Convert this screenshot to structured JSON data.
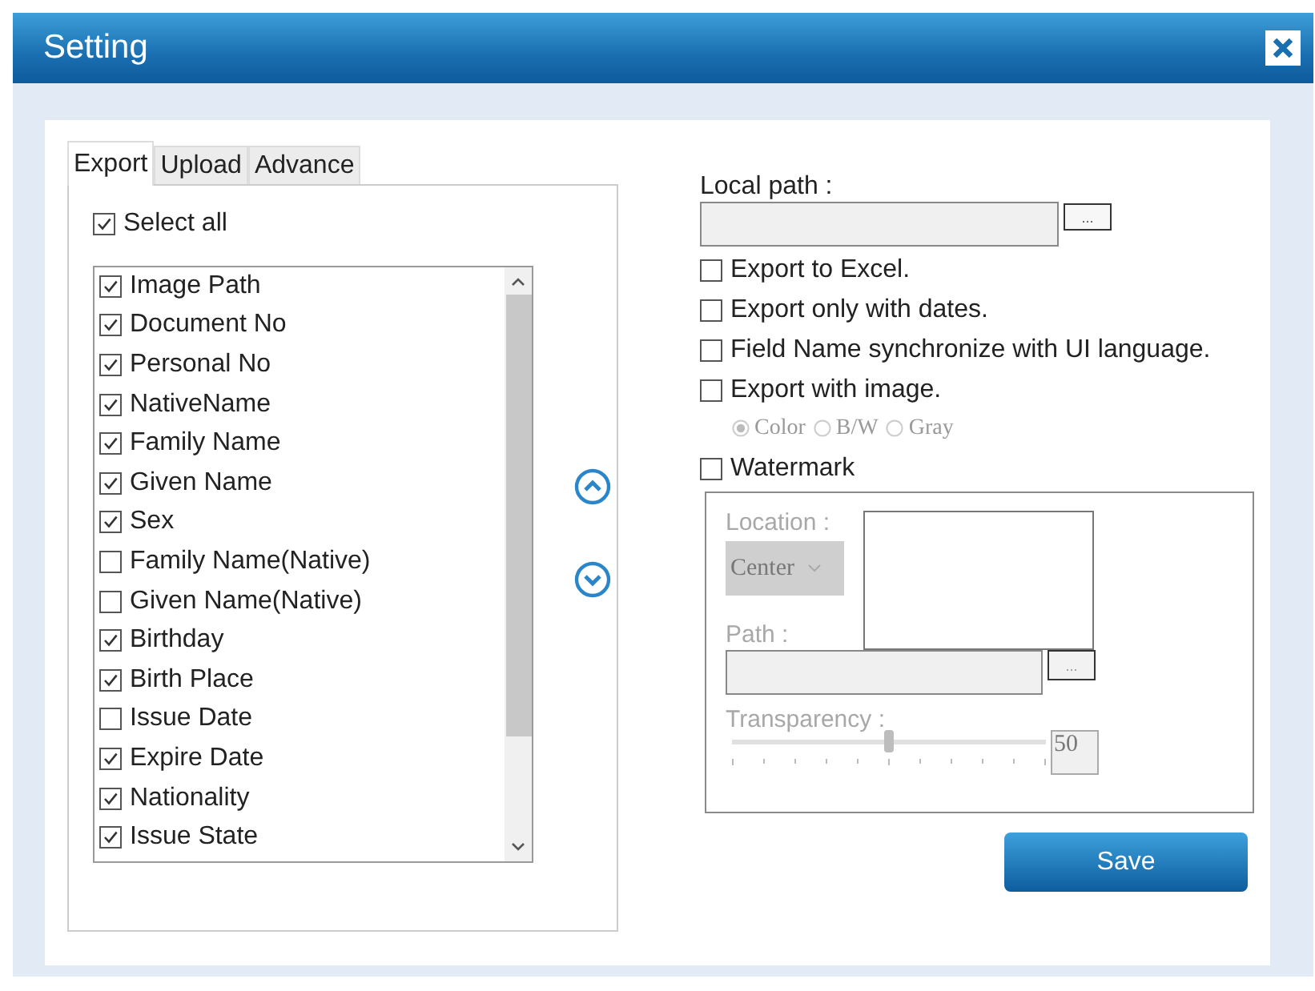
{
  "window": {
    "title": "Setting"
  },
  "tabs": [
    {
      "label": "Export",
      "selected": true
    },
    {
      "label": "Upload",
      "selected": false
    },
    {
      "label": "Advance",
      "selected": false
    }
  ],
  "select_all": {
    "label": "Select all",
    "checked": true
  },
  "fields": [
    {
      "label": "Image Path",
      "checked": true
    },
    {
      "label": "Document No",
      "checked": true
    },
    {
      "label": "Personal No",
      "checked": true
    },
    {
      "label": "NativeName",
      "checked": true
    },
    {
      "label": "Family Name",
      "checked": true
    },
    {
      "label": "Given Name",
      "checked": true
    },
    {
      "label": "Sex",
      "checked": true
    },
    {
      "label": "Family Name(Native)",
      "checked": false
    },
    {
      "label": "Given Name(Native)",
      "checked": false
    },
    {
      "label": "Birthday",
      "checked": true
    },
    {
      "label": "Birth Place",
      "checked": true
    },
    {
      "label": "Issue Date",
      "checked": false
    },
    {
      "label": "Expire Date",
      "checked": true
    },
    {
      "label": "Nationality",
      "checked": true
    },
    {
      "label": "Issue State",
      "checked": true
    }
  ],
  "local_path": {
    "label": "Local path :",
    "browse": "..."
  },
  "options": [
    {
      "label": "Export to Excel.",
      "checked": false
    },
    {
      "label": "Export only with dates.",
      "checked": false
    },
    {
      "label": "Field Name synchronize with UI language.",
      "checked": false
    },
    {
      "label": "Export with image.",
      "checked": false
    }
  ],
  "image_modes": {
    "disabled": true,
    "items": [
      {
        "label": "Color",
        "selected": true
      },
      {
        "label": "B/W",
        "selected": false
      },
      {
        "label": "Gray",
        "selected": false
      }
    ]
  },
  "watermark": {
    "label": "Watermark",
    "checked": false
  },
  "watermark_settings": {
    "disabled": true,
    "location_label": "Location :",
    "location": "Center",
    "path_label": "Path :",
    "browse": "...",
    "transparency_label": "Transparency :",
    "transparency": {
      "level": 0.5,
      "reading": "50"
    }
  },
  "save": "Save"
}
